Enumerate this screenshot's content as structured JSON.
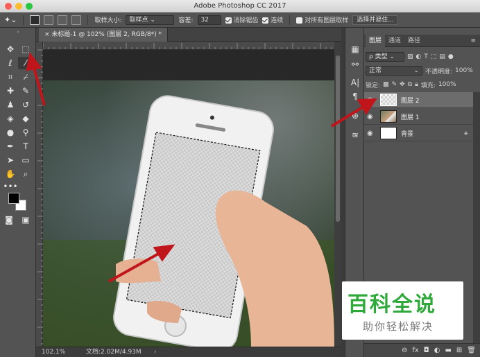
{
  "window": {
    "title": "Adobe Photoshop CC 2017"
  },
  "options_bar": {
    "sample_size_label": "取样大小:",
    "sample_size_value": "取样点",
    "tolerance_label": "容差:",
    "tolerance_value": "32",
    "anti_alias_label": "消除锯齿",
    "contiguous_label": "连续",
    "all_layers_label": "对所有图层取样",
    "select_mask_button": "选择并遮住..."
  },
  "document": {
    "tab_title": "未标题-1 @ 102% (图层 2, RGB/8*) *",
    "zoom": "102.1%",
    "doc_info": "文档:2.02M/4.93M"
  },
  "layers_panel": {
    "tabs": [
      "图层",
      "通道",
      "路径"
    ],
    "filter_kind": "ρ 类型",
    "blend_mode": "正常",
    "opacity_label": "不透明度:",
    "opacity_value": "100%",
    "lock_label": "锁定:",
    "fill_label": "填充:",
    "fill_value": "100%",
    "layers": [
      {
        "name": "图层 2",
        "selected": true
      },
      {
        "name": "图层 1",
        "selected": false
      },
      {
        "name": "背景",
        "selected": false
      }
    ]
  },
  "watermark": {
    "main": "百科全说",
    "sub": "助你轻松解决"
  },
  "colors": {
    "accent_arrow": "#c0161b",
    "watermark_green": "#2faa3a",
    "selected_layer": "#6c6c6c"
  }
}
